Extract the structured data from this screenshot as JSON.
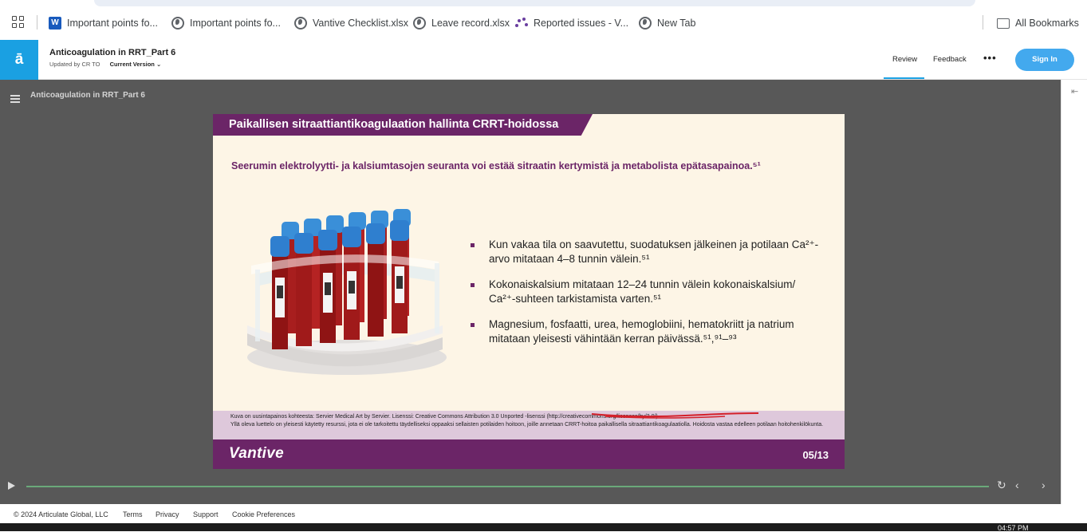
{
  "bookmarks": {
    "items": [
      {
        "label": "Important points fo...",
        "icon": "word-icon"
      },
      {
        "label": "Important points fo...",
        "icon": "globe-icon"
      },
      {
        "label": "Vantive Checklist.xlsx",
        "icon": "globe-icon"
      },
      {
        "label": "Leave record.xlsx",
        "icon": "globe-icon"
      },
      {
        "label": "Reported issues - V...",
        "icon": "loading-dots-icon"
      },
      {
        "label": "New Tab",
        "icon": "globe-icon"
      }
    ],
    "all_bookmarks": "All Bookmarks"
  },
  "header": {
    "logo": "ā",
    "course_title": "Anticoagulation in RRT_Part 6",
    "updated_by": "Updated by CR TO",
    "version": "Current Version",
    "review": "Review",
    "feedback": "Feedback",
    "more": "•••",
    "sign_in": "Sign In",
    "accent_color": "#1aa0e2"
  },
  "player": {
    "title": "Anticoagulation in RRT_Part 6",
    "progress": 0.0
  },
  "slide": {
    "banner": "Paikallisen sitraattiantikoagulaation hallinta CRRT-hoidossa",
    "subtitle": "Seerumin elektrolyytti- ja kalsiumtasojen seuranta voi estää sitraatin kertymistä ja metabolista epätasapainoa.⁵¹",
    "bullets": [
      "Kun vakaa tila on saavutettu, suodatuksen jälkeinen ja potilaan Ca²⁺-arvo mitataan 4–8 tunnin välein.⁵¹",
      "Kokonaiskalsium mitataan 12–24 tunnin välein kokonaiskalsium/ Ca²⁺-suhteen tarkistamista varten.⁵¹",
      "Magnesium, fosfaatti, urea, hemoglobiini, hematokriitt ja natrium mitataan yleisesti vähintään kerran päivässä.⁵¹,⁹¹–⁹³"
    ],
    "footnote_line1": "Kuva on uusintapainos kohteesta: Servier Medical Art by Servier. Lisenssi: Creative Commons Attribution 3.0 Unported -lisenssi (http://creativecommons.org/licenses/by/3.0/)",
    "footnote_line2": "Yllä oleva luettelo on yleisesti käytetty resurssi, jota ei ole tarkoitettu täydelliseksi oppaaksi sellaisten potilaiden hoitoon, joille annetaan CRRT-hoitoa paikallisella sitraattiantikoagulaatiolla. Hoidosta vastaa edelleen potilaan hoitohenkilökunta.",
    "brand": "Vantive",
    "page": "05/13",
    "brand_color": "#6b2567"
  },
  "footer": {
    "copyright": "© 2024 Articulate Global, LLC",
    "terms": "Terms",
    "privacy": "Privacy",
    "support": "Support",
    "cookies": "Cookie Preferences"
  },
  "taskbar": {
    "time": "04:57 PM"
  }
}
